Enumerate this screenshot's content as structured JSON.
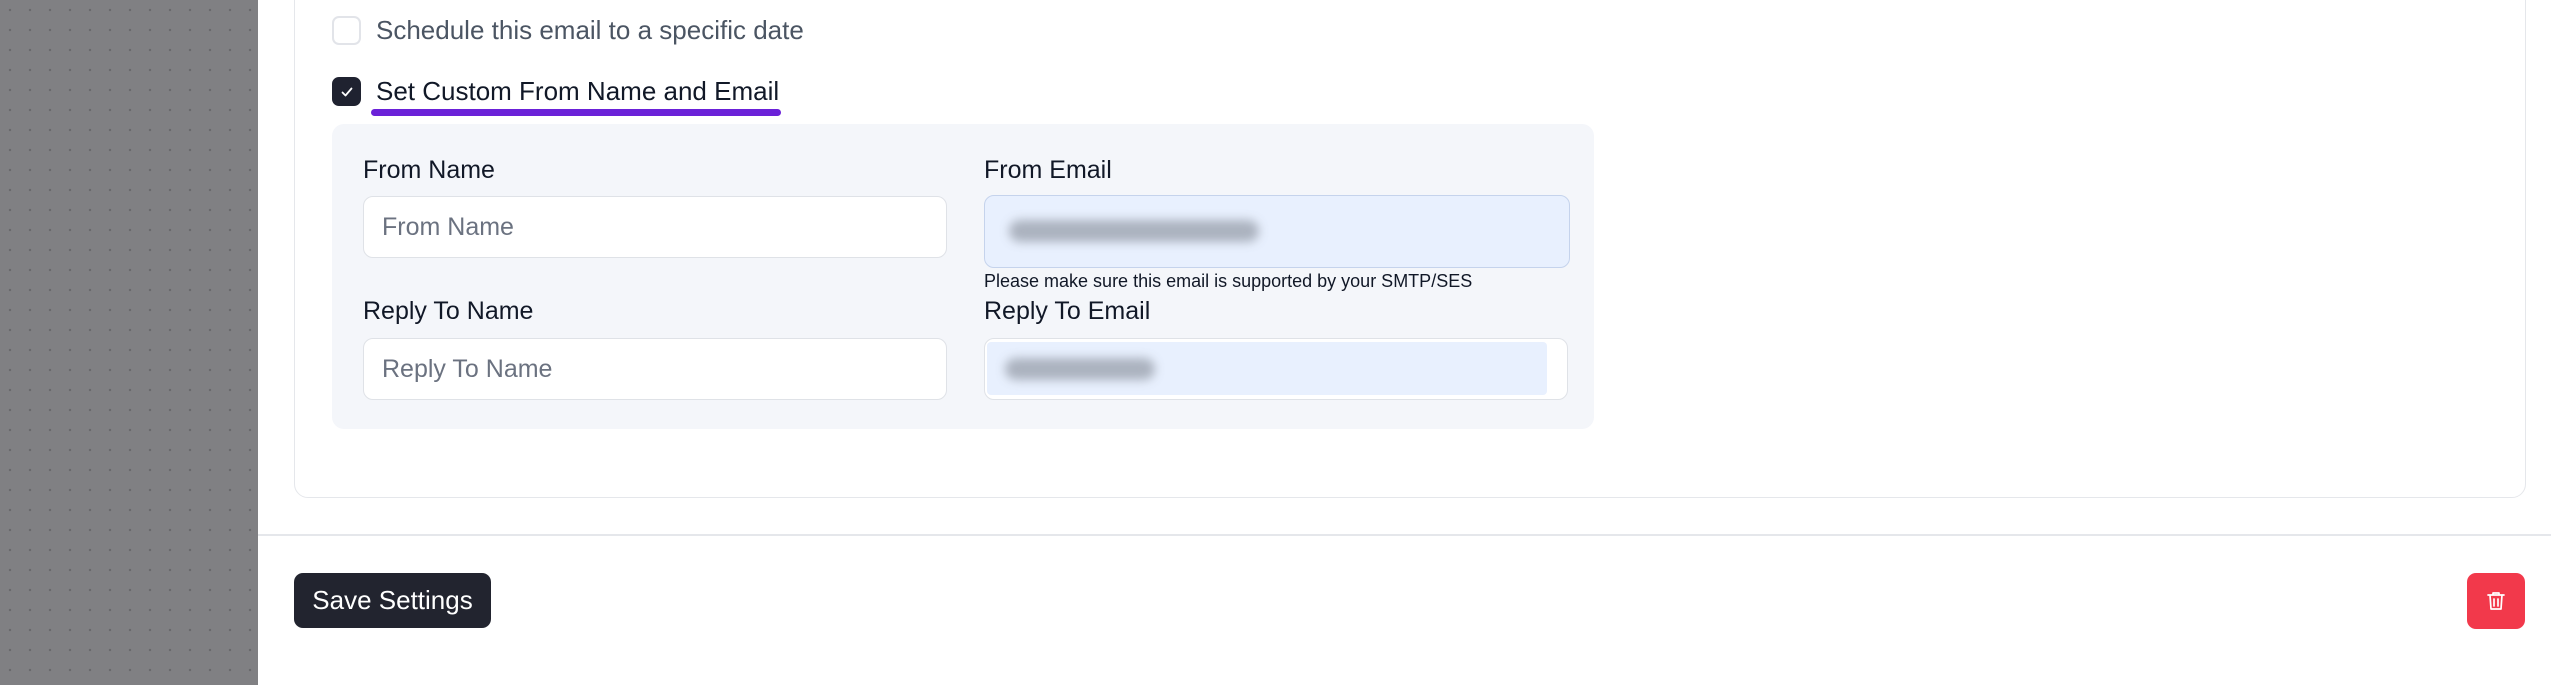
{
  "options": {
    "schedule": {
      "label": "Schedule this email to a specific date",
      "checked": false
    },
    "custom_from": {
      "label": "Set Custom From Name and Email",
      "checked": true
    }
  },
  "form": {
    "from_name": {
      "label": "From Name",
      "placeholder": "From Name",
      "value": ""
    },
    "from_email": {
      "label": "From Email",
      "value_redacted": true,
      "hint": "Please make sure this email is supported by your SMTP/SES"
    },
    "reply_to_name": {
      "label": "Reply To Name",
      "placeholder": "Reply To Name",
      "value": ""
    },
    "reply_to_email": {
      "label": "Reply To Email",
      "value_redacted": true
    }
  },
  "footer": {
    "save_label": "Save Settings",
    "delete_icon": "trash-icon"
  },
  "colors": {
    "primary_dark": "#22242f",
    "accent_underline": "#6b21d8",
    "danger": "#f2394b",
    "autofill_bg": "#e8f0fe"
  }
}
